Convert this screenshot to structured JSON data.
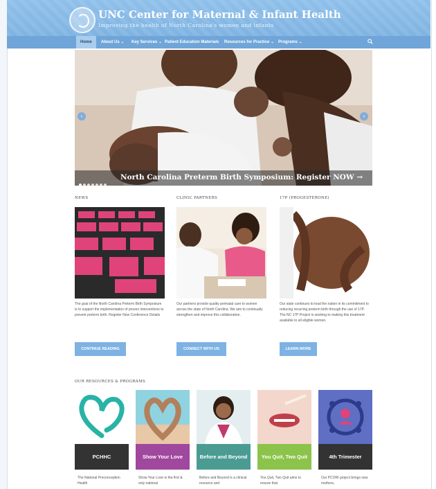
{
  "header": {
    "title": "UNC Center for Maternal & Infant Health",
    "tagline": "Improving the health of North Carolina's women and infants"
  },
  "nav": {
    "items": [
      {
        "label": "Home"
      },
      {
        "label": "About Us"
      },
      {
        "label": "Key Services"
      },
      {
        "label": "Patient Education Materials"
      },
      {
        "label": "Resources for Practice"
      },
      {
        "label": "Programs"
      }
    ],
    "search_icon": "search-icon"
  },
  "slider": {
    "caption": "North Carolina Preterm Birth Symposium: Register NOW →",
    "prev_icon": "‹",
    "next_icon": "›"
  },
  "columns": [
    {
      "heading": "NEWS",
      "text": "The goal of the North Carolina Preterm Birth Symposium is to support the implementation of proven interventions to prevent preterm birth. Register Now Conference Details",
      "button": "CONTINUE READING"
    },
    {
      "heading": "CLINIC PARTNERS",
      "text": "Our partners provide quality perinatal care to women across the state of North Carolina. We aim to continually strengthen and improve this collaboration.",
      "button": "CONNECT WITH US"
    },
    {
      "heading": "17P (PROGESTERONE)",
      "text": "Our state continues to lead the nation in its commitment to reducing recurring preterm birth through the use of 17P. The NC 17P Project is working to making this treatment available to all eligible women.",
      "button": "LEARN MORE"
    }
  ],
  "resources": {
    "heading": "OUR RESOURCES & PROGRAMS",
    "tiles": [
      {
        "label": "PCHHC",
        "text": "The National Preconception Health",
        "color": "#333333"
      },
      {
        "label": "Show Your Love",
        "text": "Show Your Love is the first & only national",
        "color": "#a0479e"
      },
      {
        "label": "Before and Beyond",
        "text": "Before and Beyond is a clinical resource and",
        "color": "#4a9c93"
      },
      {
        "label": "You Quit, Two Quit",
        "text": "You Quit, Two Quit aims to ensure that",
        "color": "#8cc34a"
      },
      {
        "label": "4th Trimester",
        "text": "Our PCORI project brings new mothers,",
        "color": "#333333"
      }
    ]
  }
}
